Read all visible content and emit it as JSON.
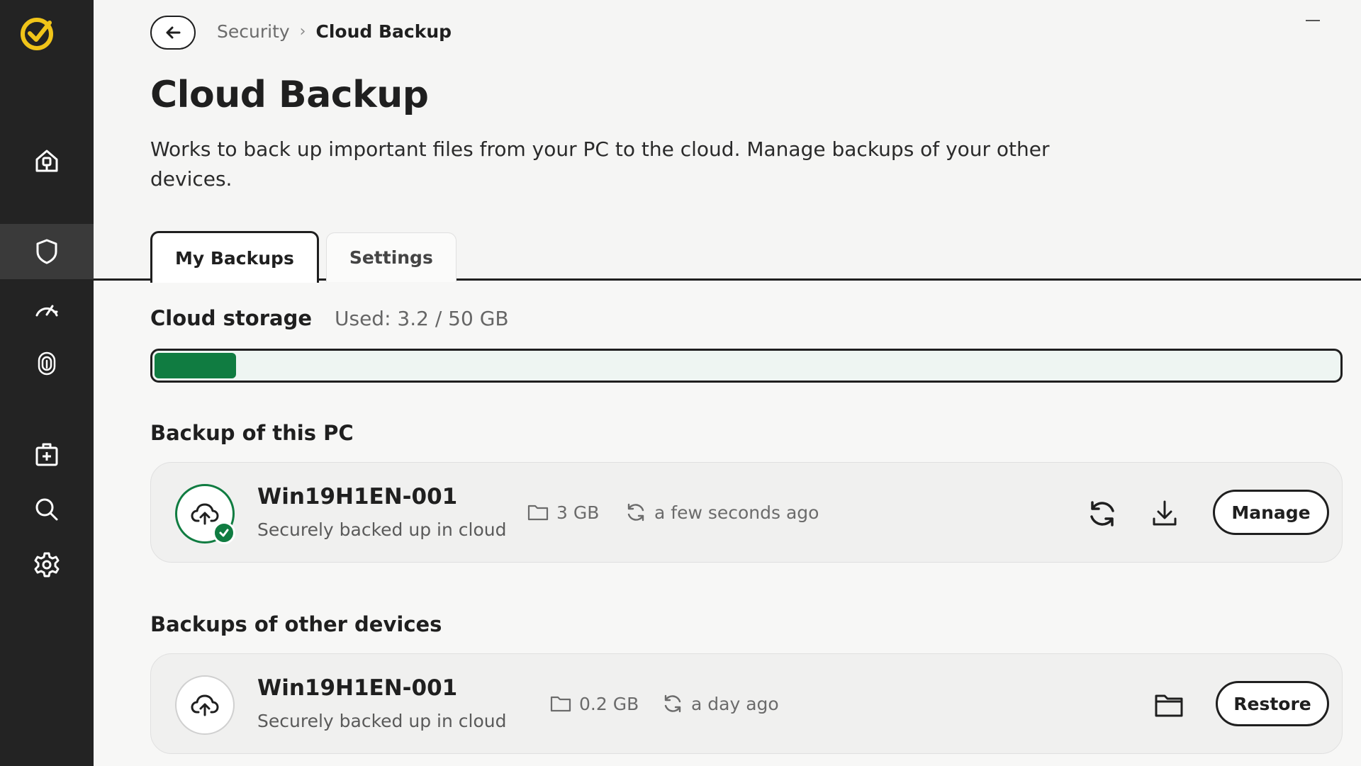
{
  "app": {
    "accent_color": "#f0c419",
    "success_color": "#107c41"
  },
  "sidebar": {
    "logo_icon": "norton-check-logo",
    "items": [
      {
        "name": "home",
        "icon": "home-icon",
        "active": false
      },
      {
        "name": "security",
        "icon": "shield-icon",
        "active": true
      },
      {
        "name": "performance",
        "icon": "speedometer-icon",
        "active": false
      },
      {
        "name": "privacy",
        "icon": "fingerprint-icon",
        "active": false
      },
      {
        "name": "extras",
        "icon": "medical-kit-icon",
        "active": false
      },
      {
        "name": "search",
        "icon": "search-icon",
        "active": false
      },
      {
        "name": "settings",
        "icon": "gear-icon",
        "active": false
      }
    ]
  },
  "header": {
    "back_icon": "arrow-left-icon",
    "breadcrumb": {
      "parent": "Security",
      "current": "Cloud Backup"
    },
    "title": "Cloud Backup",
    "description": "Works to back up important files from your PC to the cloud. Manage backups of your other devices."
  },
  "tabs": [
    {
      "label": "My Backups",
      "active": true
    },
    {
      "label": "Settings",
      "active": false
    }
  ],
  "storage": {
    "title": "Cloud storage",
    "used_text": "Used: 3.2 / 50 GB",
    "used_gb": 3.2,
    "total_gb": 50
  },
  "this_pc": {
    "section_title": "Backup of this PC",
    "device": {
      "name": "Win19H1EN-001",
      "status": "Securely backed up in cloud",
      "size": "3 GB",
      "last_backup": "a few seconds ago",
      "manage_label": "Manage"
    }
  },
  "other_devices": {
    "section_title": "Backups of other devices",
    "device": {
      "name": "Win19H1EN-001",
      "status": "Securely backed up in cloud",
      "size": "0.2 GB",
      "last_backup": "a day ago",
      "restore_label": "Restore"
    }
  }
}
